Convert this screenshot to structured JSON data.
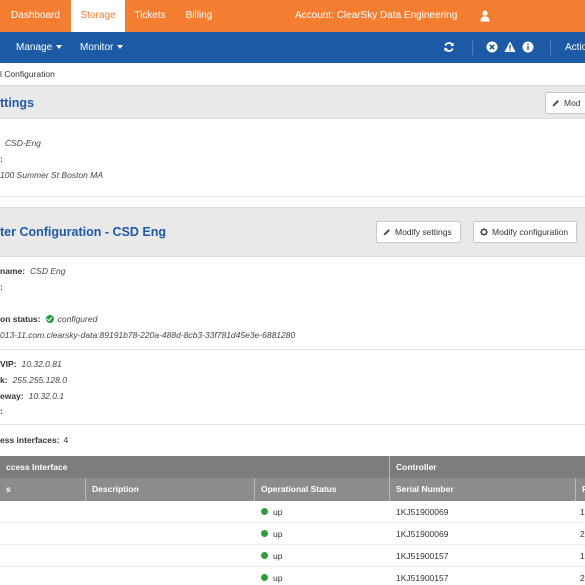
{
  "topnav": {
    "tabs": [
      "Dashboard",
      "Storage",
      "Tickets",
      "Billing"
    ],
    "active_tab": "Storage",
    "account": "Account: ClearSky Data Engineering"
  },
  "subnav": {
    "manage": "Manage",
    "monitor": "Monitor",
    "actions": "Actio"
  },
  "breadcrumb": "l Configuration",
  "site_section": {
    "title": "ttings",
    "modify_button": "Mod",
    "name_value": "CSD-Eng",
    "address_label": ":",
    "address_value": "100 Summer St Boston MA"
  },
  "cluster_section": {
    "title": "ter Configuration - CSD Eng",
    "modify_settings": "Modify settings",
    "modify_configuration": "Modify configuration",
    "name_label": "name:",
    "name_value": "CSD Eng",
    "empty_label": ":",
    "status_label": "on status:",
    "status_value": "configured",
    "iqn": "013-11.com.clearsky-data:89191b78-220a-488d-8cb3-33f781d45e3e-6881280",
    "vip_label": "VIP:",
    "vip_value": "10.32.0.81",
    "netmask_label": "k:",
    "netmask_value": "255.255.128.0",
    "gateway_label": "eway:",
    "gateway_value": "10.32.0.1",
    "extra_label": ":",
    "interfaces_label": "ess interfaces:",
    "interfaces_count": "4"
  },
  "table": {
    "group_access": "ccess Interface",
    "group_controller": "Controller",
    "headers": [
      "s",
      "Description",
      "Operational Status",
      "Serial Number",
      "F"
    ],
    "rows": [
      {
        "status": "up",
        "serial": "1KJ51900069",
        "extra": "1"
      },
      {
        "status": "up",
        "serial": "1KJ51900069",
        "extra": "2"
      },
      {
        "status": "up",
        "serial": "1KJ51900157",
        "extra": "1"
      },
      {
        "status": "up",
        "serial": "1KJ51900157",
        "extra": "2"
      }
    ]
  },
  "colors": {
    "brand_orange": "#f47d30",
    "nav_blue": "#1c5aa5",
    "status_green": "#2e9d3a"
  },
  "icons": [
    "user-icon",
    "refresh-icon",
    "close-circle-icon",
    "warning-icon",
    "info-icon",
    "pencil-icon",
    "gear-icon",
    "check-circle-icon",
    "status-dot-icon"
  ]
}
